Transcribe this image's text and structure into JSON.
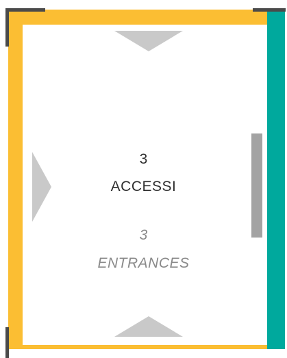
{
  "labels": {
    "it_count": "3",
    "it_label": "ACCESSI",
    "en_count": "3",
    "en_label": "ENTRANCES"
  },
  "colors": {
    "yellow_border": "#FBBE33",
    "teal_border": "#00A99D",
    "corner_marks": "#4A4A4A",
    "side_bar": "#A3A3A3",
    "entrance_arrows": "#C9C9C9",
    "text_primary": "#2E2E2E",
    "text_secondary": "#8A8A8A"
  },
  "icons": {
    "top_entrance": "triangle-down-icon",
    "bottom_entrance": "triangle-up-icon",
    "left_entrance": "triangle-right-icon"
  }
}
